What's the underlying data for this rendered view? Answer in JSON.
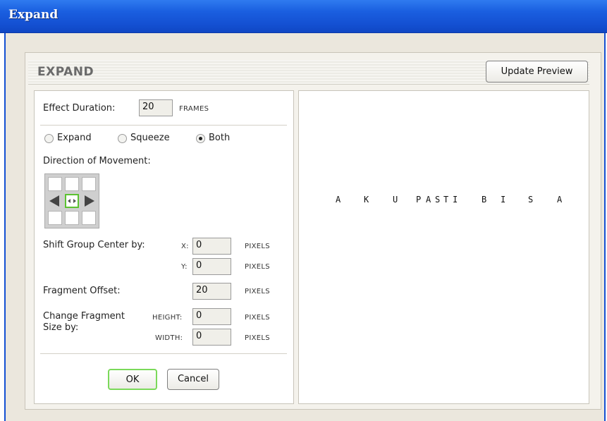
{
  "window": {
    "title": "Expand"
  },
  "header": {
    "title": "EXPAND",
    "update_preview_label": "Update Preview"
  },
  "effect_duration": {
    "label": "Effect Duration:",
    "value": "20",
    "unit": "FRAMES"
  },
  "modes": {
    "options": [
      "Expand",
      "Squeeze",
      "Both"
    ],
    "selected": "Both"
  },
  "direction": {
    "label": "Direction of Movement:",
    "selected_cell": "center"
  },
  "shift_group_center": {
    "label": "Shift Group Center by:",
    "x_label": "X:",
    "x_value": "0",
    "x_unit": "PIXELS",
    "y_label": "Y:",
    "y_value": "0",
    "y_unit": "PIXELS"
  },
  "fragment_offset": {
    "label": "Fragment Offset:",
    "value": "20",
    "unit": "PIXELS"
  },
  "fragment_size": {
    "label_line1": "Change Fragment",
    "label_line2": "Size by:",
    "height_label": "HEIGHT:",
    "height_value": "0",
    "height_unit": "PIXELS",
    "width_label": "WIDTH:",
    "width_value": "0",
    "width_unit": "PIXELS"
  },
  "buttons": {
    "ok": "OK",
    "cancel": "Cancel"
  },
  "preview": {
    "letters": [
      "A",
      "K",
      "U",
      "P",
      "A",
      "S",
      "T",
      "I",
      "B",
      "I",
      "S",
      "A"
    ]
  },
  "colors": {
    "title_bar": "#1450d2",
    "selected_green": "#5cc232",
    "panel_bg": "#f4f2ec"
  }
}
